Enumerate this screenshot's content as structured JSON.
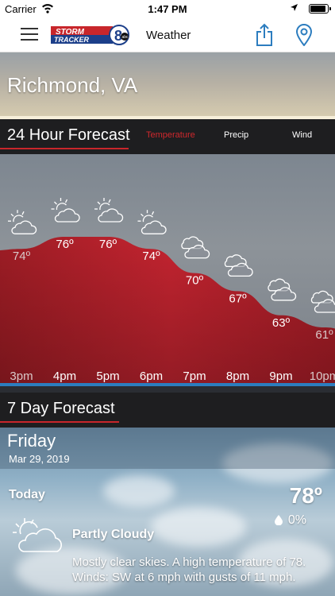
{
  "status_bar": {
    "carrier": "Carrier",
    "time": "1:47 PM"
  },
  "nav": {
    "title": "Weather",
    "logo_text_top": "STORM",
    "logo_text_bottom": "TRACKER",
    "logo_number": "8",
    "logo_network": "abc"
  },
  "location": {
    "city": "Richmond, VA"
  },
  "hourly": {
    "header": "24 Hour Forecast",
    "tabs": [
      {
        "label": "Temperature",
        "active": true
      },
      {
        "label": "Precip",
        "active": false
      },
      {
        "label": "Wind",
        "active": false
      }
    ],
    "hours": [
      {
        "time": "3pm",
        "temp": "74º",
        "value": 74,
        "icon": "partly-sunny-icon"
      },
      {
        "time": "4pm",
        "temp": "76º",
        "value": 76,
        "icon": "partly-sunny-icon"
      },
      {
        "time": "5pm",
        "temp": "76º",
        "value": 76,
        "icon": "partly-sunny-icon"
      },
      {
        "time": "6pm",
        "temp": "74º",
        "value": 74,
        "icon": "partly-sunny-icon"
      },
      {
        "time": "7pm",
        "temp": "70º",
        "value": 70,
        "icon": "cloudy-icon"
      },
      {
        "time": "8pm",
        "temp": "67º",
        "value": 67,
        "icon": "cloudy-icon"
      },
      {
        "time": "9pm",
        "temp": "63º",
        "value": 63,
        "icon": "cloudy-icon"
      },
      {
        "time": "10pm",
        "temp": "61º",
        "value": 61,
        "icon": "cloudy-icon"
      }
    ],
    "fill_color": "#b8202a"
  },
  "seven_day": {
    "header": "7 Day Forecast",
    "day": "Friday",
    "date": "Mar 29, 2019",
    "period": "Today",
    "high": "78º",
    "precip": "0%",
    "condition": "Partly Cloudy",
    "icon": "partly-cloudy-icon",
    "description": "Mostly clear skies.  A high temperature of 78.  Winds: SW at 6 mph with gusts of 11 mph."
  },
  "colors": {
    "accent": "#d0282d",
    "divider": "#2c7dbf"
  }
}
